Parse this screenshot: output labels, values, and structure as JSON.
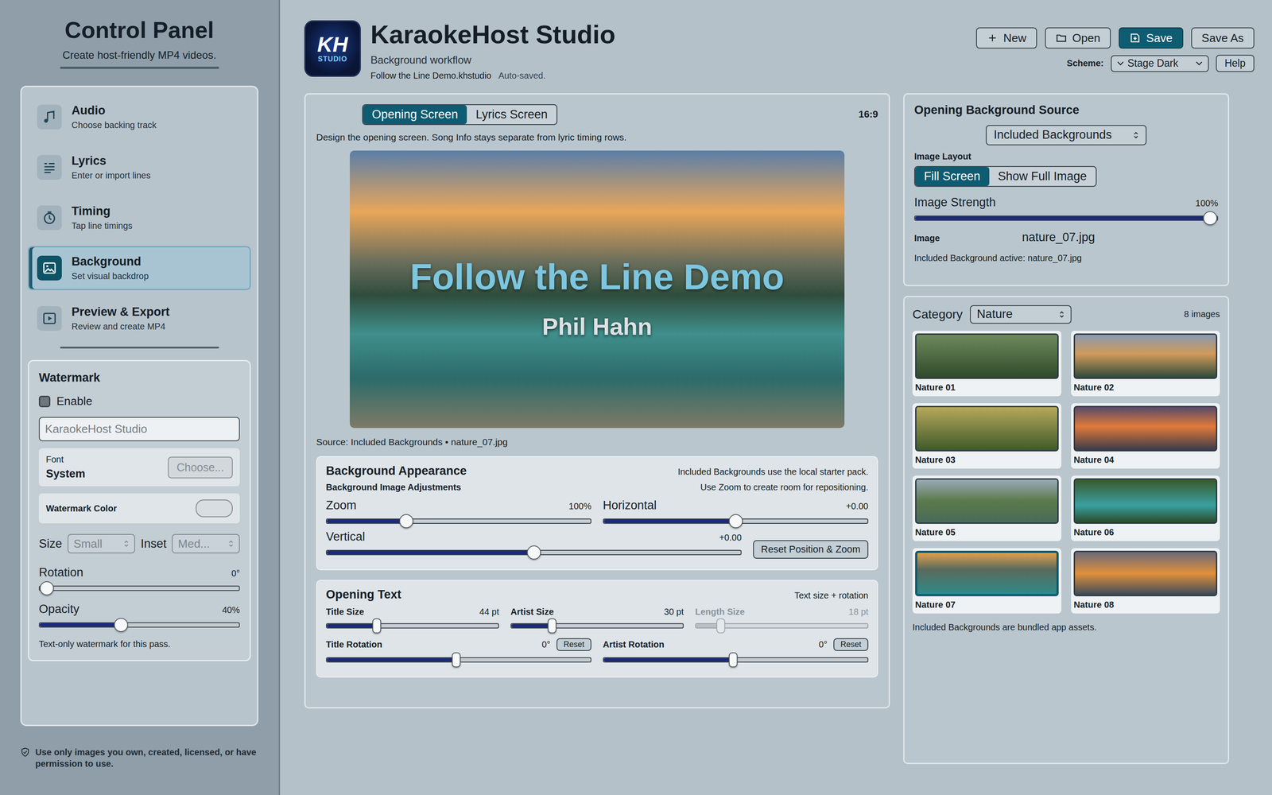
{
  "window": {
    "title": "KaraokeHost Studio"
  },
  "sidebar": {
    "title": "Control Panel",
    "subtitle": "Create host-friendly MP4 videos.",
    "items": [
      {
        "label": "Audio",
        "sub": "Choose backing track",
        "selected": false
      },
      {
        "label": "Lyrics",
        "sub": "Enter or import lines",
        "selected": false
      },
      {
        "label": "Timing",
        "sub": "Tap line timings",
        "selected": false
      },
      {
        "label": "Background",
        "sub": "Set visual backdrop",
        "selected": true
      },
      {
        "label": "Preview & Export",
        "sub": "Review and create MP4",
        "selected": false
      }
    ],
    "footer_note": "Use only images you own, created, licensed, or have permission to use."
  },
  "watermark": {
    "title": "Watermark",
    "enable_label": "Enable",
    "enabled": false,
    "text_field": {
      "value": "KaraokeHost Studio",
      "placeholder": true
    },
    "font_label": "Font",
    "font_value": "System",
    "choose_button": {
      "label": "Choose...",
      "disabled": true
    },
    "color_label": "Watermark Color",
    "color_disabled": true,
    "selects": [
      {
        "label": "Size",
        "value": "Small",
        "disabled": true
      },
      {
        "label": "Inset",
        "value": "Med...",
        "disabled": true
      }
    ],
    "sliders": [
      {
        "label": "Rotation",
        "reading": "0°",
        "level": 0
      },
      {
        "label": "Opacity",
        "reading": "40%",
        "level": 0.4
      }
    ],
    "note": "Text-only watermark for this pass."
  },
  "header": {
    "logo_text": "KH",
    "logo_sub": "STUDIO",
    "title": "KaraokeHost Studio",
    "subtitle": "Background workflow",
    "file": "Follow the Line Demo.khstudio",
    "save_status": "Auto-saved.",
    "buttons": [
      {
        "label": "New",
        "primary": false
      },
      {
        "label": "Open",
        "primary": false
      },
      {
        "label": "Save",
        "primary": true
      },
      {
        "label": "Save As",
        "primary": false
      }
    ],
    "scheme_label": "Scheme:",
    "scheme_value": "Stage Dark",
    "help": "Help"
  },
  "editor": {
    "tabs": [
      {
        "label": "Opening Screen",
        "selected": true
      },
      {
        "label": "Lyrics Screen",
        "selected": false
      }
    ],
    "aspect": "16:9",
    "description": "Design the opening screen. Song Info stays separate from lyric timing rows.",
    "preview": {
      "title": "Follow the Line Demo",
      "artist": "Phil Hahn"
    },
    "source": "Source: Included Backgrounds • nature_07.jpg",
    "appearance": {
      "title": "Background Appearance",
      "note": "Included Backgrounds use the local starter pack.",
      "subtitle": "Background Image Adjustments",
      "subnote": "Use Zoom to create room for repositioning.",
      "sliders": [
        {
          "label": "Zoom",
          "reading": "100%",
          "level": 0.29
        },
        {
          "label": "Horizontal",
          "reading": "+0.00",
          "level": 0.5
        },
        {
          "label": "Vertical",
          "reading": "+0.00",
          "level": 0.5
        }
      ],
      "reset": "Reset Position & Zoom"
    },
    "opening_text": {
      "title": "Opening Text",
      "note": "Text size + rotation",
      "sizes": [
        {
          "label": "Title Size",
          "reading": "44 pt",
          "level": 0.29,
          "disabled": false
        },
        {
          "label": "Artist Size",
          "reading": "30 pt",
          "level": 0.23,
          "disabled": false
        },
        {
          "label": "Length Size",
          "reading": "18 pt",
          "level": 0.13,
          "disabled": true
        }
      ],
      "rotations": [
        {
          "label": "Title Rotation",
          "reading": "0°",
          "level": 0.5,
          "reset": "Reset"
        },
        {
          "label": "Artist Rotation",
          "reading": "0°",
          "level": 0.5,
          "reset": "Reset"
        }
      ]
    }
  },
  "source_panel": {
    "title": "Opening Background Source",
    "source_value": "Included Backgrounds",
    "layout_label": "Image Layout",
    "layouts": [
      {
        "label": "Fill Screen",
        "selected": true
      },
      {
        "label": "Show Full Image",
        "selected": false
      }
    ],
    "strength": {
      "label": "Image Strength",
      "reading": "100%",
      "level": 1
    },
    "image_label": "Image",
    "image_value": "nature_07.jpg",
    "active_note": "Included Background active: nature_07.jpg"
  },
  "gallery": {
    "category_label": "Category",
    "category_value": "Nature",
    "count": "8 images",
    "images": [
      {
        "label": "Nature 01",
        "selected": false
      },
      {
        "label": "Nature 02",
        "selected": false
      },
      {
        "label": "Nature 03",
        "selected": false
      },
      {
        "label": "Nature 04",
        "selected": false
      },
      {
        "label": "Nature 05",
        "selected": false
      },
      {
        "label": "Nature 06",
        "selected": false
      },
      {
        "label": "Nature 07",
        "selected": true
      },
      {
        "label": "Nature 08",
        "selected": false
      }
    ],
    "note": "Included Backgrounds are bundled app assets."
  }
}
